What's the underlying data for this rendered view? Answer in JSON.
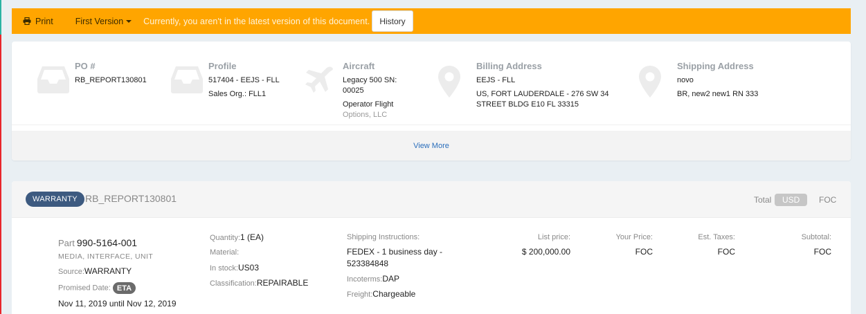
{
  "banner": {
    "print_label": "Print",
    "version_label": "First Version",
    "notice": "Currently, you aren't in the latest version of this document.",
    "history_label": "History",
    "color": "#ffa500"
  },
  "summary": {
    "po": {
      "title": "PO #",
      "lines": [
        "RB_REPORT130801"
      ],
      "icon": "inbox-icon"
    },
    "profile": {
      "title": "Profile",
      "lines": [
        "517404 - EEJS - FLL",
        "Sales Org.: FLL1"
      ],
      "icon": "inbox-icon"
    },
    "aircraft": {
      "title": "Aircraft",
      "lines": [
        "Legacy 500 SN:",
        "00025"
      ],
      "operator": [
        "Operator Flight",
        "Options, LLC"
      ],
      "icon": "airplane-icon"
    },
    "billing": {
      "title": "Billing Address",
      "lines": [
        "EEJS - FLL",
        "US, FORT LAUDERDALE - 276 SW 34",
        "STREET BLDG E10 FL 33315"
      ],
      "icon": "map-pin-icon"
    },
    "shipping": {
      "title": "Shipping Address",
      "lines": [
        "novo",
        "BR, new2 new1 RN 333"
      ],
      "icon": "map-pin-icon"
    },
    "view_more": "View More"
  },
  "item": {
    "badge": "WARRANTY",
    "reference": "RB_REPORT130801",
    "total_label": "Total",
    "currency": "USD",
    "total_value": "FOC",
    "part_label": "Part",
    "part_number": "990-5164-001",
    "description": "MEDIA, INTERFACE, UNIT",
    "source_label": "Source:",
    "source_value": "WARRANTY",
    "promised_label": "Promised Date:",
    "eta_badge": "ETA",
    "promised_range": "Nov 11, 2019 until Nov 12, 2019",
    "quantity_label": "Quantity:",
    "quantity_value": "1 (EA)",
    "material_label": "Material:",
    "stock_label": "In stock:",
    "stock_value": "US03",
    "classification_label": "Classification:",
    "classification_value": "REPAIRABLE",
    "shipping_instr_label": "Shipping Instructions:",
    "shipping_instr_line1": "FEDEX - 1 business day -",
    "shipping_instr_line2": "523384848",
    "incoterms_label": "Incoterms:",
    "incoterms_value": "DAP",
    "freight_label": "Freight:",
    "freight_value": "Chargeable",
    "list_price_label": "List price:",
    "list_price_value": "$ 200,000.00",
    "your_price_label": "Your Price:",
    "your_price_value": "FOC",
    "taxes_label": "Est. Taxes:",
    "taxes_value": "FOC",
    "subtotal_label": "Subtotal:",
    "subtotal_value": "FOC"
  }
}
